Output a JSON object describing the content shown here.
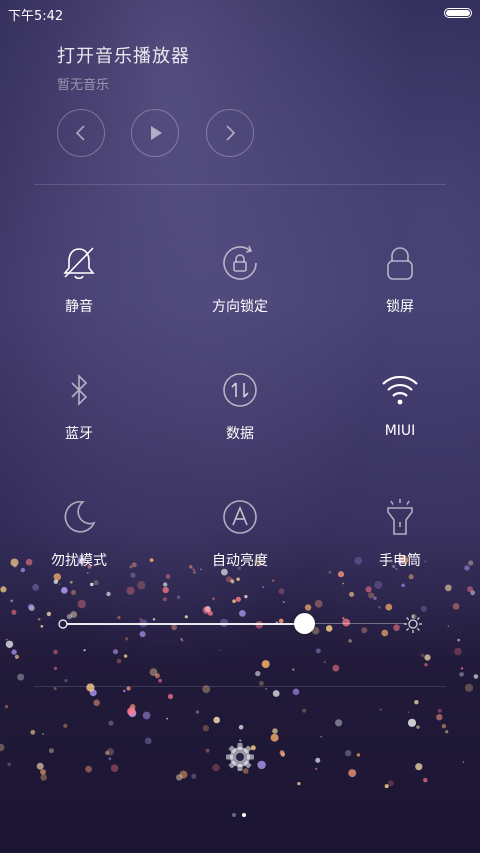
{
  "status": {
    "time": "下午5:42"
  },
  "music": {
    "title": "打开音乐播放器",
    "subtitle": "暂无音乐"
  },
  "media_controls": {
    "prev_icon": "chevron-left-icon",
    "play_icon": "play-icon",
    "next_icon": "chevron-right-icon"
  },
  "toggles": [
    {
      "label": "静音",
      "icon": "bell-off-icon"
    },
    {
      "label": "方向锁定",
      "icon": "rotation-lock-icon"
    },
    {
      "label": "锁屏",
      "icon": "lock-icon"
    },
    {
      "label": "蓝牙",
      "icon": "bluetooth-icon"
    },
    {
      "label": "数据",
      "icon": "mobile-data-icon"
    },
    {
      "label": "MIUI",
      "icon": "wifi-icon"
    },
    {
      "label": "勿扰模式",
      "icon": "moon-icon"
    },
    {
      "label": "自动亮度",
      "icon": "auto-brightness-icon"
    },
    {
      "label": "手电筒",
      "icon": "flashlight-icon"
    }
  ],
  "brightness": {
    "level": 0.7
  },
  "pager": {
    "pages": 2,
    "current": 2
  },
  "colors": {
    "background_top": "#2a2550",
    "background_bottom": "#1b1532",
    "accent": "#ffffff"
  }
}
